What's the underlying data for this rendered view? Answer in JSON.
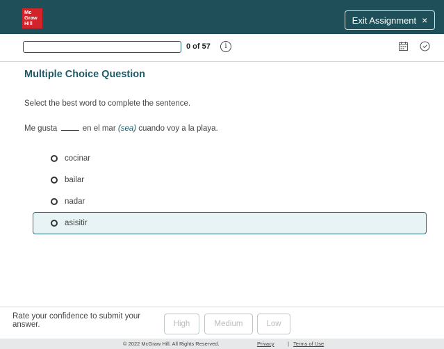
{
  "header": {
    "logo_lines": [
      "Mc",
      "Graw",
      "Hill"
    ],
    "exit_label": "Exit Assignment",
    "exit_icon": "×"
  },
  "progress": {
    "count_text": "0 of 57",
    "fraction": 0,
    "info_icon": "i"
  },
  "question": {
    "title": "Multiple Choice Question",
    "instruction": "Select the best word to complete the sentence.",
    "sentence_before": "Me gusta",
    "sentence_middle": "en el mar",
    "sentence_hint": "(sea)",
    "sentence_after": "cuando voy a la playa.",
    "options": [
      "cocinar",
      "bailar",
      "nadar",
      "asisitir"
    ],
    "selected_option": "asisitir"
  },
  "confidence": {
    "prompt": "Rate your confidence to submit your answer.",
    "buttons": [
      "High",
      "Medium",
      "Low"
    ]
  },
  "footer": {
    "copyright": "© 2022 McGraw Hill. All Rights Reserved.",
    "privacy": "Privacy",
    "separator": "|",
    "terms": "Terms of Use"
  },
  "colors": {
    "header_bg": "#1f4f58",
    "logo_red": "#d2232a",
    "accent_teal": "#1f5a66",
    "selected_bg": "#e7f3f5"
  }
}
